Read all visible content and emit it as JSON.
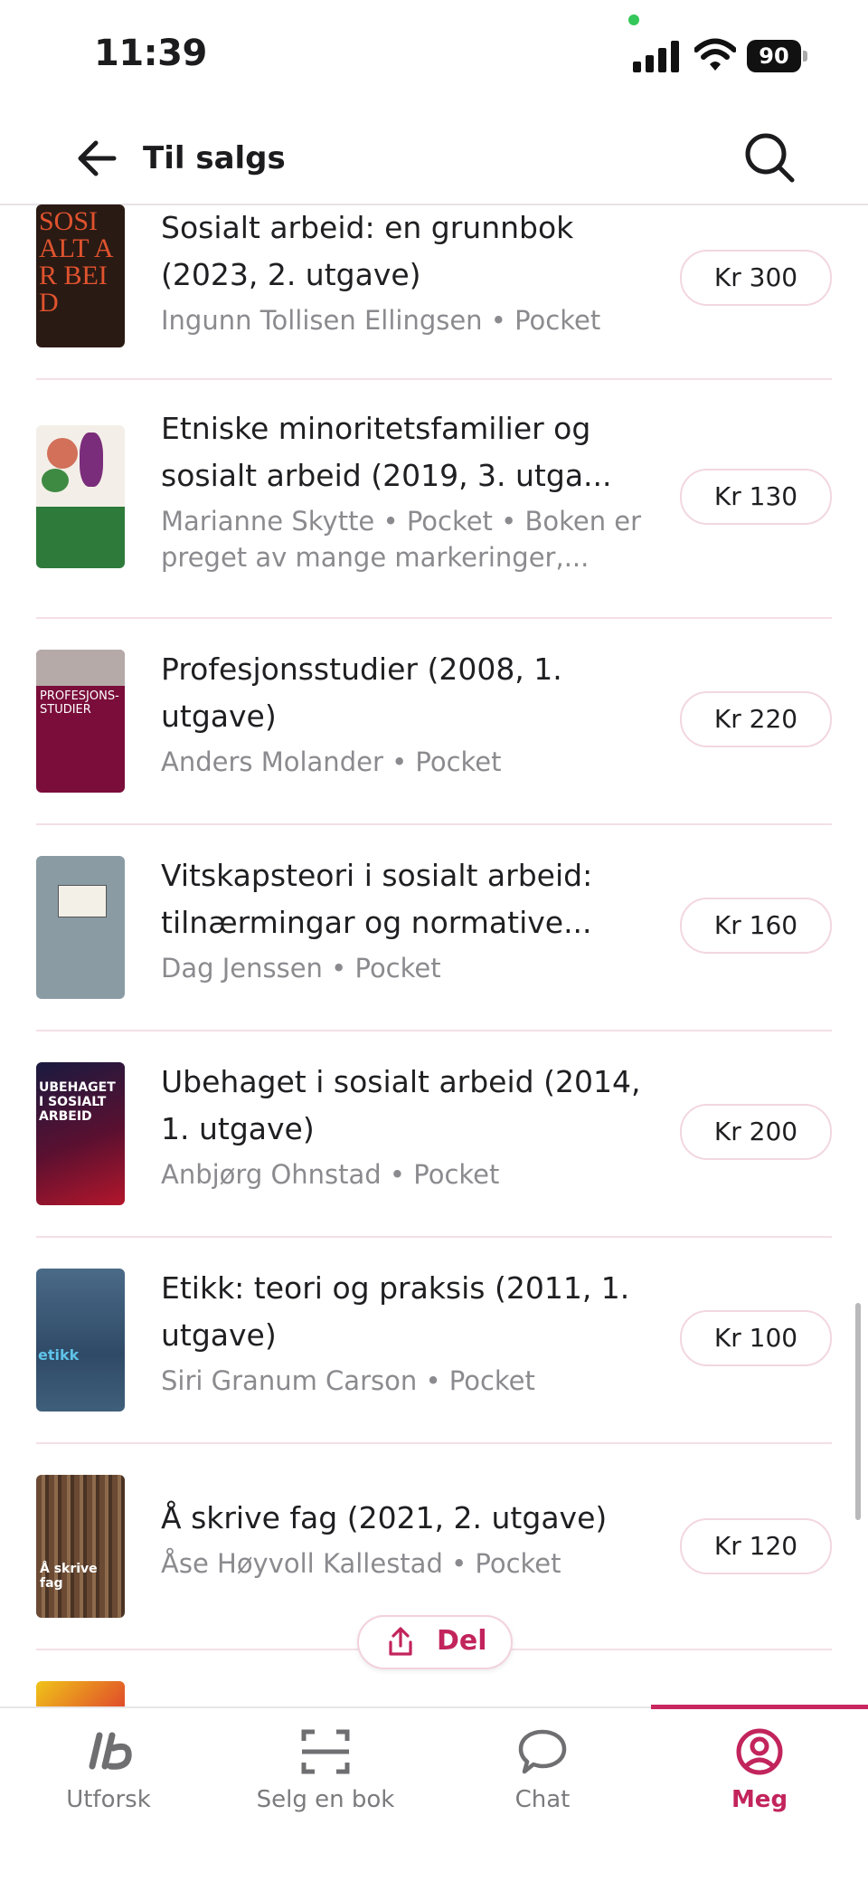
{
  "status_bar": {
    "time": "11:39",
    "battery": "90"
  },
  "header": {
    "title": "Til salgs"
  },
  "books": [
    {
      "title": "Sosialt arbeid: en grunnbok (2023, 2. utgave)",
      "meta": "Ingunn Tollisen Ellingsen • Pocket",
      "price": "Kr 300",
      "cover_color": "#2a1a14",
      "cover_text": "SOSI ALT AR BEID"
    },
    {
      "title": "Etniske minoritetsfamilier og sosialt arbeid (2019, 3. utga...",
      "meta": "Marianne Skytte • Pocket • Boken er preget av mange markeringer,...",
      "price": "Kr 130",
      "cover_color": "#2e7a3a",
      "cover_text": ""
    },
    {
      "title": "Profesjonsstudier (2008, 1. utgave)",
      "meta": "Anders Molander • Pocket",
      "price": "Kr 220",
      "cover_color": "#7a0d3a",
      "cover_text": "PROFESJONS-STUDIER"
    },
    {
      "title": "Vitskapsteori i sosialt arbeid: tilnærmingar og normative...",
      "meta": "Dag Jenssen • Pocket",
      "price": "Kr 160",
      "cover_color": "#8a9ba3",
      "cover_text": ""
    },
    {
      "title": "Ubehaget i sosialt arbeid (2014, 1. utgave)",
      "meta": "Anbjørg Ohnstad • Pocket",
      "price": "Kr 200",
      "cover_color": "#5a1030",
      "cover_text": "UBEHAGET I SOSIALT ARBEID"
    },
    {
      "title": "Etikk: teori og praksis (2011, 1. utgave)",
      "meta": "Siri Granum Carson • Pocket",
      "price": "Kr 100",
      "cover_color": "#2f4a66",
      "cover_text": "etikk"
    },
    {
      "title": "Å skrive fag (2021, 2. utgave)",
      "meta": "Åse Høyvoll Kallestad • Pocket",
      "price": "Kr 120",
      "cover_color": "#5b4432",
      "cover_text": "Å skrive fag"
    }
  ],
  "share_button": {
    "label": "Del"
  },
  "tabs": [
    {
      "label": "Utforsk",
      "icon": "explore-logo-icon"
    },
    {
      "label": "Selg en bok",
      "icon": "scan-icon"
    },
    {
      "label": "Chat",
      "icon": "chat-bubble-icon"
    },
    {
      "label": "Meg",
      "icon": "profile-icon"
    }
  ],
  "colors": {
    "accent": "#c2245c",
    "price_border": "#f2d7e0",
    "divider": "#f4dfe6"
  }
}
